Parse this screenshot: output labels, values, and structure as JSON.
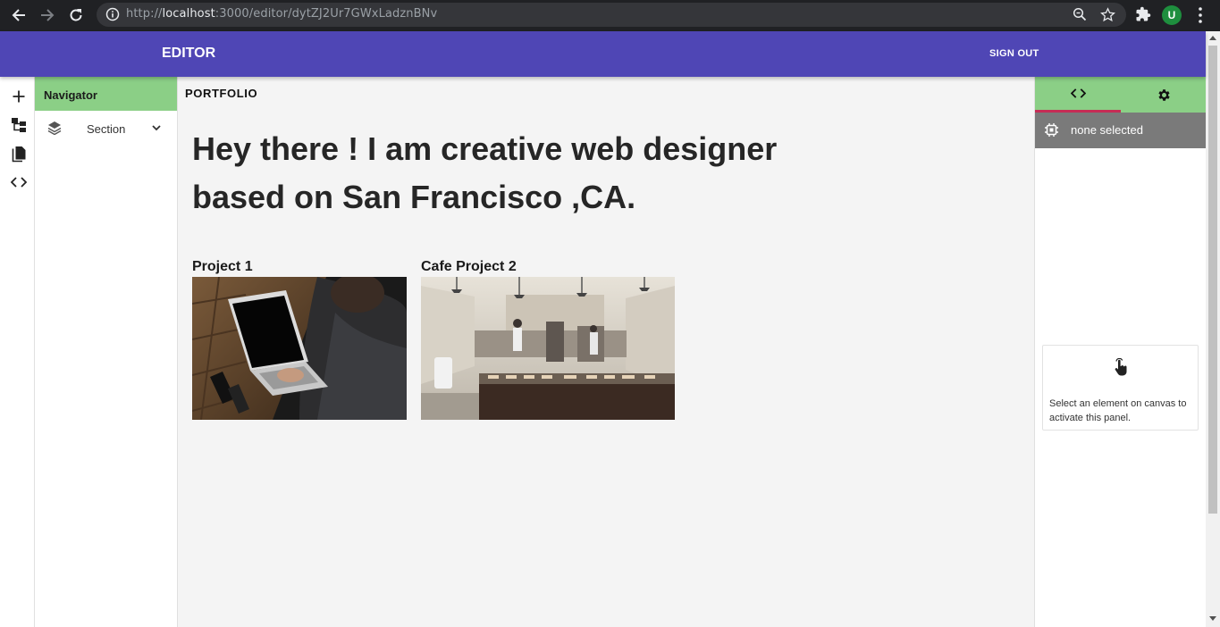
{
  "browser": {
    "url_prefix": "http://",
    "url_host": "localhost",
    "url_rest": ":3000/editor/dytZJ2Ur7GWxLadznBNv",
    "profile_initial": "U",
    "icons": [
      "back-arrow-icon",
      "forward-arrow-icon",
      "reload-icon",
      "info-icon",
      "zoom-icon",
      "star-icon",
      "puzzle-icon",
      "kebab-menu-icon"
    ]
  },
  "header": {
    "title": "EDITOR",
    "signout_label": "SIGN OUT",
    "color": "#4f46b5"
  },
  "rail": {
    "items": [
      {
        "name": "add",
        "icon": "plus-icon"
      },
      {
        "name": "layers-tree",
        "icon": "tree-icon"
      },
      {
        "name": "pages",
        "icon": "pages-icon"
      },
      {
        "name": "code",
        "icon": "code-icon"
      }
    ]
  },
  "navigator": {
    "title": "Navigator",
    "items": [
      {
        "label": "Section",
        "icon": "layers-icon",
        "expand_icon": "chevron-down-icon"
      }
    ],
    "accent": "#8bcf86"
  },
  "canvas": {
    "brand": "PORTFOLIO",
    "headline": "Hey there ! I am creative web designer based on San Francisco ,CA.",
    "projects": [
      {
        "title": "Project 1",
        "image": "laptop-photo"
      },
      {
        "title": "Cafe Project 2",
        "image": "cafe-kitchen-photo"
      }
    ]
  },
  "right_panel": {
    "tabs": [
      {
        "icon": "code-icon",
        "active": true
      },
      {
        "icon": "gear-icon",
        "active": false
      }
    ],
    "selection_label": "none selected",
    "hint_text": "Select an element on canvas to activate this panel.",
    "active_tab_color": "#c62c55"
  }
}
